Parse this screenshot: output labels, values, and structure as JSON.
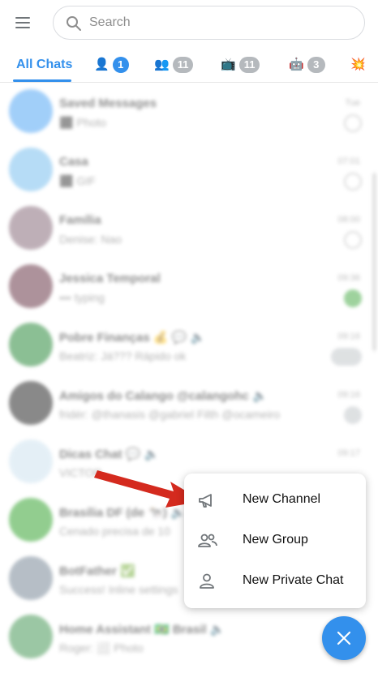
{
  "search": {
    "placeholder": "Search"
  },
  "tabs": [
    {
      "label": "All Chats",
      "active": true
    },
    {
      "icon": "👤",
      "badge": "1"
    },
    {
      "icon": "👥",
      "badge": "11"
    },
    {
      "icon": "📺",
      "badge": "11"
    },
    {
      "icon": "🤖",
      "badge": "3"
    },
    {
      "icon": "💥"
    }
  ],
  "chats": [
    {
      "name": "Saved Messages",
      "message": "⬛ Photo",
      "time": "Tue"
    },
    {
      "name": "Casa",
      "message": "⬛ GIF",
      "time": "07:01"
    },
    {
      "name": "Família",
      "message": "Denise: Nao",
      "time": "08:00"
    },
    {
      "name": "Jessica Temporal",
      "message": "••• typing",
      "time": "09:36"
    },
    {
      "name": "Pobre Finanças 💰 💬 🔈",
      "message": "Beatriz: Já??? Rápido ok",
      "time": "09:16"
    },
    {
      "name": "Amigos do Calango @calangohc 🔈",
      "message": "fridér: @thanasis @gabriel Filth @ocameiro",
      "time": "09:16"
    },
    {
      "name": "Dicas Chat 💬 🔈",
      "message": "VICTOR",
      "time": "09:17"
    },
    {
      "name": "Brasília DF (de 🐄) 🔈",
      "message": "Cenado precisa de 10",
      "time": ""
    },
    {
      "name": "BotFather ✅",
      "message": "Success! Inline settings",
      "time": ""
    },
    {
      "name": "Home Assistant 🇧🇷 Brasil 🔈",
      "message": "Roger: ⬜ Photo",
      "time": ""
    }
  ],
  "menu": {
    "items": [
      {
        "label": "New Channel",
        "icon": "megaphone-icon"
      },
      {
        "label": "New Group",
        "icon": "group-icon"
      },
      {
        "label": "New Private Chat",
        "icon": "person-icon"
      }
    ]
  },
  "colors": {
    "accent": "#3390ec",
    "arrow": "#d42a1e",
    "online": "#4fae4e"
  }
}
